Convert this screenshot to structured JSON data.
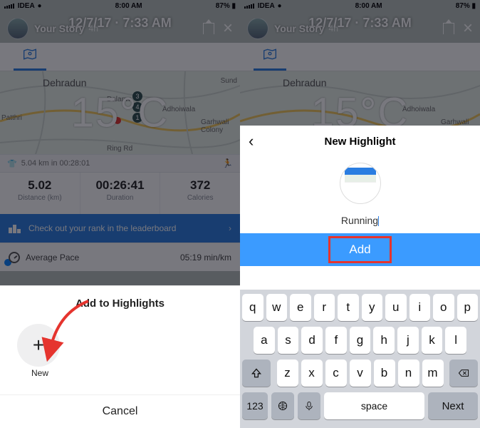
{
  "statusbar": {
    "carrier": "IDEA",
    "time": "8:00 AM",
    "battery": "87%"
  },
  "story": {
    "title": "Your Story",
    "age": "4h",
    "timestamp": "12/7/17 · 7:33 AM"
  },
  "map": {
    "temp": "15°C",
    "labels": {
      "dehradun": "Dehradun",
      "dalanw": "Dalanw",
      "adhoiwala": "Adhoiwala",
      "patthri": "Patthri",
      "garhwali": "Garhwali Colony",
      "sund": "Sund",
      "ring": "Ring Rd"
    },
    "markers": [
      "3",
      "4",
      "1"
    ]
  },
  "summary": {
    "text": "5.04 km in 00:28:01"
  },
  "stats": {
    "distance": {
      "val": "5.02",
      "lbl": "Distance (km)"
    },
    "duration": {
      "val": "00:26:41",
      "lbl": "Duration"
    },
    "calories": {
      "val": "372",
      "lbl": "Calories"
    }
  },
  "leaderboard": {
    "text": "Check out your rank in the leaderboard"
  },
  "pace": {
    "label": "Average Pace",
    "value": "05:19 min/km"
  },
  "sheet_left": {
    "title": "Add to Highlights",
    "new": "New",
    "cancel": "Cancel"
  },
  "sheet_right": {
    "title": "New Highlight",
    "name": "Running",
    "add": "Add"
  },
  "keyboard": {
    "r1": [
      "q",
      "w",
      "e",
      "r",
      "t",
      "y",
      "u",
      "i",
      "o",
      "p"
    ],
    "r2": [
      "a",
      "s",
      "d",
      "f",
      "g",
      "h",
      "j",
      "k",
      "l"
    ],
    "r3": [
      "z",
      "x",
      "c",
      "v",
      "b",
      "n",
      "m"
    ],
    "num": "123",
    "space": "space",
    "next": "Next"
  }
}
